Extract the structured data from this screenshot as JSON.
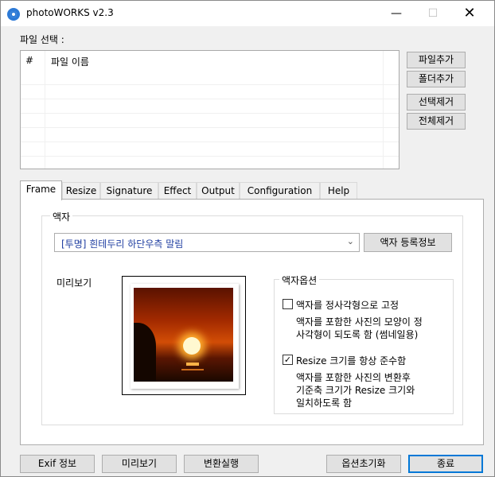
{
  "window": {
    "title": "photoWORKS v2.3",
    "minimize": "—",
    "maximize": "☐",
    "close": "✕"
  },
  "file_section": {
    "label": "파일 선택 :",
    "columns": [
      "#",
      "파일 이름"
    ],
    "rows": []
  },
  "file_buttons": {
    "add_file": "파일추가",
    "add_folder": "폴더추가",
    "remove_selected": "선택제거",
    "remove_all": "전체제거"
  },
  "tabs": [
    {
      "label": "Frame",
      "active": true
    },
    {
      "label": "Resize",
      "active": false
    },
    {
      "label": "Signature",
      "active": false
    },
    {
      "label": "Effect",
      "active": false
    },
    {
      "label": "Output",
      "active": false
    },
    {
      "label": "Configuration",
      "active": false
    },
    {
      "label": "Help",
      "active": false
    }
  ],
  "frame": {
    "group_title": "액자",
    "selected_frame": "[투명] 흰테두리 하단우측 말림",
    "frame_info_button": "액자 등록정보",
    "preview_label": "미리보기",
    "options": {
      "group_title": "액자옵션",
      "square": {
        "label": "액자를 정사각형으로 고정",
        "checked": false,
        "desc": [
          "액자를 포함한 사진의 모양이 정",
          "사각형이 되도록 함 (썸네일용)"
        ]
      },
      "resize": {
        "label": "Resize 크기를 항상 준수함",
        "checked": true,
        "desc": [
          "액자를 포함한 사진의 변환후",
          "기준축 크기가 Resize 크기와",
          "일치하도록 함"
        ]
      }
    }
  },
  "bottom_buttons": {
    "exif": "Exif 정보",
    "preview": "미리보기",
    "convert": "변환실행",
    "reset_options": "옵션초기화",
    "exit": "종료"
  }
}
